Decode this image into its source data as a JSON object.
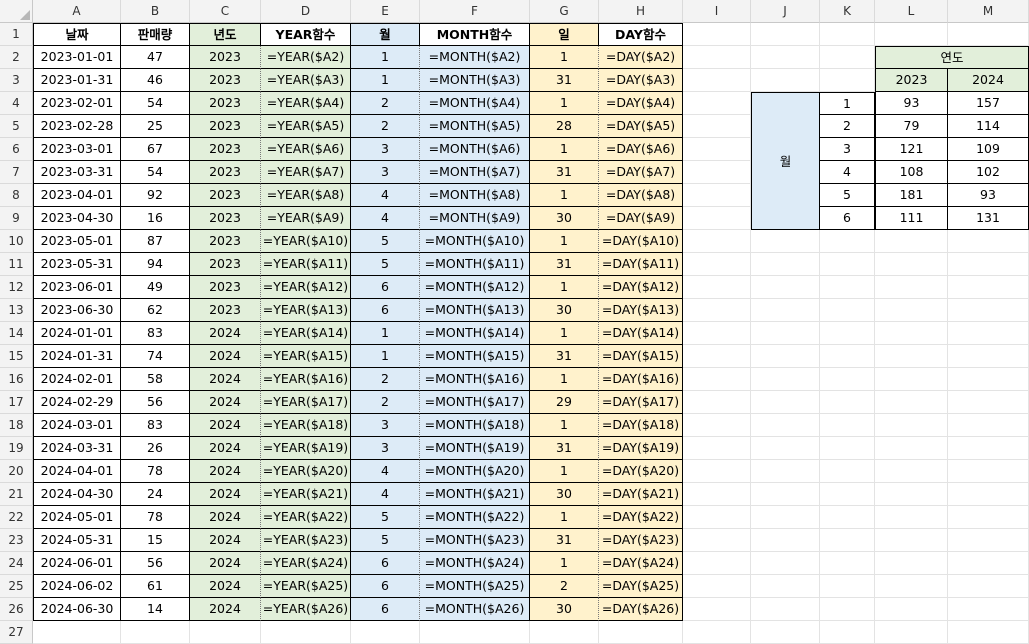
{
  "columns": [
    "A",
    "B",
    "C",
    "D",
    "E",
    "F",
    "G",
    "H",
    "I",
    "J",
    "K",
    "L",
    "M"
  ],
  "rows": [
    "1",
    "2",
    "3",
    "4",
    "5",
    "6",
    "7",
    "8",
    "9",
    "10",
    "11",
    "12",
    "13",
    "14",
    "15",
    "16",
    "17",
    "18",
    "19",
    "20",
    "21",
    "22",
    "23",
    "24",
    "25",
    "26",
    "27"
  ],
  "main_table": {
    "headers": [
      "날짜",
      "판매량",
      "년도",
      "YEAR함수",
      "월",
      "MONTH함수",
      "일",
      "DAY함수"
    ],
    "data": [
      [
        "2023-01-01",
        "47",
        "2023",
        "=YEAR($A2)",
        "1",
        "=MONTH($A2)",
        "1",
        "=DAY($A2)"
      ],
      [
        "2023-01-31",
        "46",
        "2023",
        "=YEAR($A3)",
        "1",
        "=MONTH($A3)",
        "31",
        "=DAY($A3)"
      ],
      [
        "2023-02-01",
        "54",
        "2023",
        "=YEAR($A4)",
        "2",
        "=MONTH($A4)",
        "1",
        "=DAY($A4)"
      ],
      [
        "2023-02-28",
        "25",
        "2023",
        "=YEAR($A5)",
        "2",
        "=MONTH($A5)",
        "28",
        "=DAY($A5)"
      ],
      [
        "2023-03-01",
        "67",
        "2023",
        "=YEAR($A6)",
        "3",
        "=MONTH($A6)",
        "1",
        "=DAY($A6)"
      ],
      [
        "2023-03-31",
        "54",
        "2023",
        "=YEAR($A7)",
        "3",
        "=MONTH($A7)",
        "31",
        "=DAY($A7)"
      ],
      [
        "2023-04-01",
        "92",
        "2023",
        "=YEAR($A8)",
        "4",
        "=MONTH($A8)",
        "1",
        "=DAY($A8)"
      ],
      [
        "2023-04-30",
        "16",
        "2023",
        "=YEAR($A9)",
        "4",
        "=MONTH($A9)",
        "30",
        "=DAY($A9)"
      ],
      [
        "2023-05-01",
        "87",
        "2023",
        "=YEAR($A10)",
        "5",
        "=MONTH($A10)",
        "1",
        "=DAY($A10)"
      ],
      [
        "2023-05-31",
        "94",
        "2023",
        "=YEAR($A11)",
        "5",
        "=MONTH($A11)",
        "31",
        "=DAY($A11)"
      ],
      [
        "2023-06-01",
        "49",
        "2023",
        "=YEAR($A12)",
        "6",
        "=MONTH($A12)",
        "1",
        "=DAY($A12)"
      ],
      [
        "2023-06-30",
        "62",
        "2023",
        "=YEAR($A13)",
        "6",
        "=MONTH($A13)",
        "30",
        "=DAY($A13)"
      ],
      [
        "2024-01-01",
        "83",
        "2024",
        "=YEAR($A14)",
        "1",
        "=MONTH($A14)",
        "1",
        "=DAY($A14)"
      ],
      [
        "2024-01-31",
        "74",
        "2024",
        "=YEAR($A15)",
        "1",
        "=MONTH($A15)",
        "31",
        "=DAY($A15)"
      ],
      [
        "2024-02-01",
        "58",
        "2024",
        "=YEAR($A16)",
        "2",
        "=MONTH($A16)",
        "1",
        "=DAY($A16)"
      ],
      [
        "2024-02-29",
        "56",
        "2024",
        "=YEAR($A17)",
        "2",
        "=MONTH($A17)",
        "29",
        "=DAY($A17)"
      ],
      [
        "2024-03-01",
        "83",
        "2024",
        "=YEAR($A18)",
        "3",
        "=MONTH($A18)",
        "1",
        "=DAY($A18)"
      ],
      [
        "2024-03-31",
        "26",
        "2024",
        "=YEAR($A19)",
        "3",
        "=MONTH($A19)",
        "31",
        "=DAY($A19)"
      ],
      [
        "2024-04-01",
        "78",
        "2024",
        "=YEAR($A20)",
        "4",
        "=MONTH($A20)",
        "1",
        "=DAY($A20)"
      ],
      [
        "2024-04-30",
        "24",
        "2024",
        "=YEAR($A21)",
        "4",
        "=MONTH($A21)",
        "30",
        "=DAY($A21)"
      ],
      [
        "2024-05-01",
        "78",
        "2024",
        "=YEAR($A22)",
        "5",
        "=MONTH($A22)",
        "1",
        "=DAY($A22)"
      ],
      [
        "2024-05-31",
        "15",
        "2024",
        "=YEAR($A23)",
        "5",
        "=MONTH($A23)",
        "31",
        "=DAY($A23)"
      ],
      [
        "2024-06-01",
        "56",
        "2024",
        "=YEAR($A24)",
        "6",
        "=MONTH($A24)",
        "1",
        "=DAY($A24)"
      ],
      [
        "2024-06-02",
        "61",
        "2024",
        "=YEAR($A25)",
        "6",
        "=MONTH($A25)",
        "2",
        "=DAY($A25)"
      ],
      [
        "2024-06-30",
        "14",
        "2024",
        "=YEAR($A26)",
        "6",
        "=MONTH($A26)",
        "30",
        "=DAY($A26)"
      ]
    ]
  },
  "pivot": {
    "year_header": "연도",
    "years": [
      "2023",
      "2024"
    ],
    "month_label": "월",
    "months": [
      "1",
      "2",
      "3",
      "4",
      "5",
      "6"
    ],
    "values": [
      [
        "93",
        "157"
      ],
      [
        "79",
        "114"
      ],
      [
        "121",
        "109"
      ],
      [
        "108",
        "102"
      ],
      [
        "181",
        "93"
      ],
      [
        "111",
        "131"
      ]
    ]
  },
  "colors": {
    "green": "#e2efda",
    "blue": "#ddebf7",
    "yellow": "#fff2cc"
  }
}
